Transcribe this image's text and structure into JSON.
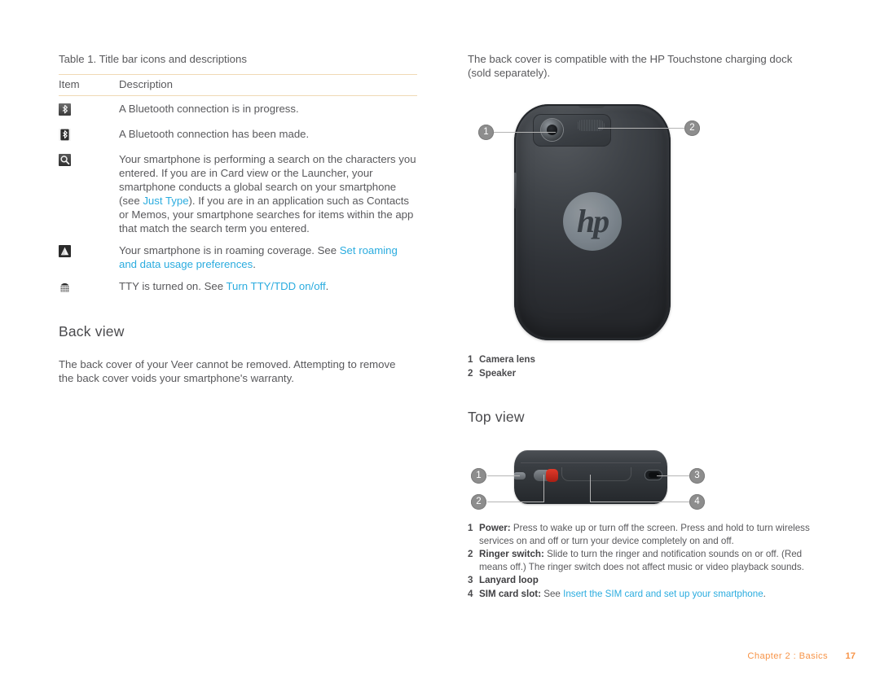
{
  "table": {
    "caption": "Table 1.  Title bar icons and descriptions",
    "headers": {
      "item": "Item",
      "description": "Description"
    },
    "rows": [
      {
        "icon": "bluetooth-in-progress-icon",
        "parts": [
          {
            "type": "text",
            "text": "A Bluetooth connection is in progress."
          }
        ]
      },
      {
        "icon": "bluetooth-connected-icon",
        "parts": [
          {
            "type": "text",
            "text": "A Bluetooth connection has been made."
          }
        ]
      },
      {
        "icon": "search-icon",
        "parts": [
          {
            "type": "text",
            "text": "Your smartphone is performing a search on the characters you entered. If you are in Card view or the Launcher, your smartphone conducts a global search on your smartphone (see "
          },
          {
            "type": "link",
            "text": "Just Type"
          },
          {
            "type": "text",
            "text": "). If you are in an application such as Contacts or Memos, your smartphone searches for items within the app that match the search term you entered."
          }
        ]
      },
      {
        "icon": "roaming-icon",
        "parts": [
          {
            "type": "text",
            "text": "Your smartphone is in roaming coverage. See "
          },
          {
            "type": "link",
            "text": "Set roaming and data usage preferences"
          },
          {
            "type": "text",
            "text": "."
          }
        ]
      },
      {
        "icon": "tty-icon",
        "parts": [
          {
            "type": "text",
            "text": "TTY is turned on. See "
          },
          {
            "type": "link",
            "text": "Turn TTY/TDD on/off"
          },
          {
            "type": "text",
            "text": "."
          }
        ]
      }
    ]
  },
  "back_view": {
    "heading": "Back view",
    "paragraph": "The back cover of your Veer cannot be removed. Attempting to remove the back cover voids your smartphone's warranty.",
    "intro": "The back cover is compatible with the HP Touchstone charging dock (sold separately).",
    "phone_logo": "hp",
    "callouts": [
      {
        "num": "1",
        "label": "Camera lens"
      },
      {
        "num": "2",
        "label": "Speaker"
      }
    ]
  },
  "top_view": {
    "heading": "Top view",
    "callouts": [
      {
        "num": "1",
        "label": "Power:",
        "bold": "Power:",
        "text": " Press to wake up or turn off the screen. Press and hold to turn wireless services on and off or turn your device completely on and off."
      },
      {
        "num": "2",
        "label": "Ringer switch:",
        "bold": "Ringer switch:",
        "text": " Slide to turn the ringer and notification sounds on or off. (Red means off.) The ringer switch does not affect music or video playback sounds."
      },
      {
        "num": "3",
        "label": "Lanyard loop",
        "bold": "Lanyard loop",
        "text": ""
      },
      {
        "num": "4",
        "label": "SIM card slot:",
        "bold": "SIM card slot:",
        "text": " See ",
        "link": "Insert the SIM card and set up your smartphone",
        "tail": "."
      }
    ]
  },
  "footer": {
    "chapter": "Chapter 2  :  Basics",
    "page": "17"
  },
  "colors": {
    "link": "#2bacdf",
    "footer": "#f79448",
    "rule": "#f0d9b5",
    "body_text": "#59595c"
  }
}
